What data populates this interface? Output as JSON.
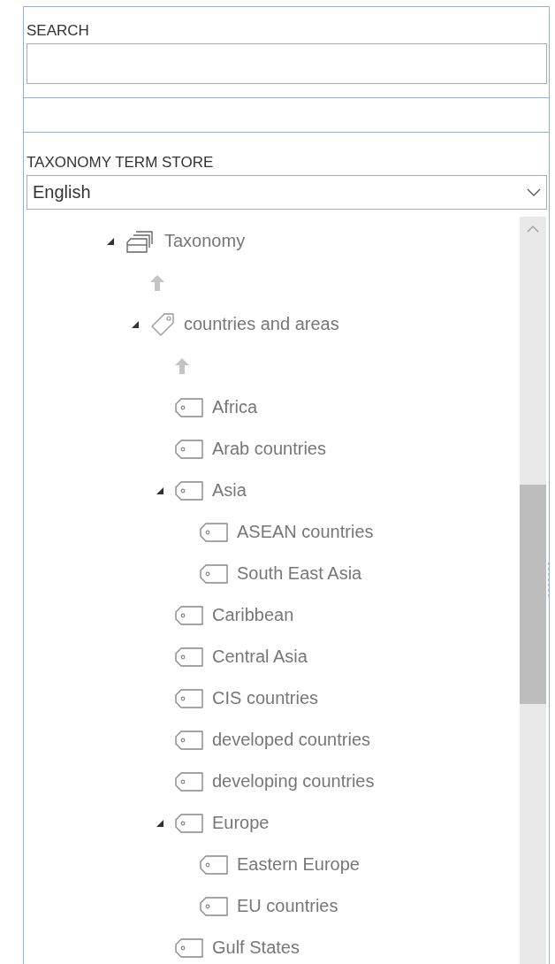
{
  "search": {
    "label": "SEARCH"
  },
  "term_store": {
    "label": "TAXONOMY TERM STORE",
    "language": "English"
  },
  "tree": [
    {
      "kind": "termset-group",
      "label": "Taxonomy",
      "expanded": true,
      "children": [
        {
          "kind": "up-arrow"
        },
        {
          "kind": "termset",
          "label": "countries and areas",
          "expanded": true,
          "children": [
            {
              "kind": "up-arrow"
            },
            {
              "kind": "term",
              "label": "Africa"
            },
            {
              "kind": "term",
              "label": "Arab countries"
            },
            {
              "kind": "term",
              "label": "Asia",
              "expanded": true,
              "children": [
                {
                  "kind": "term",
                  "label": "ASEAN countries"
                },
                {
                  "kind": "term",
                  "label": "South East Asia"
                }
              ]
            },
            {
              "kind": "term",
              "label": "Caribbean"
            },
            {
              "kind": "term",
              "label": "Central Asia"
            },
            {
              "kind": "term",
              "label": "CIS countries"
            },
            {
              "kind": "term",
              "label": "developed countries"
            },
            {
              "kind": "term",
              "label": "developing countries"
            },
            {
              "kind": "term",
              "label": "Europe",
              "expanded": true,
              "children": [
                {
                  "kind": "term",
                  "label": "Eastern Europe"
                },
                {
                  "kind": "term",
                  "label": "EU countries"
                }
              ]
            },
            {
              "kind": "term",
              "label": "Gulf States"
            }
          ]
        }
      ]
    }
  ]
}
